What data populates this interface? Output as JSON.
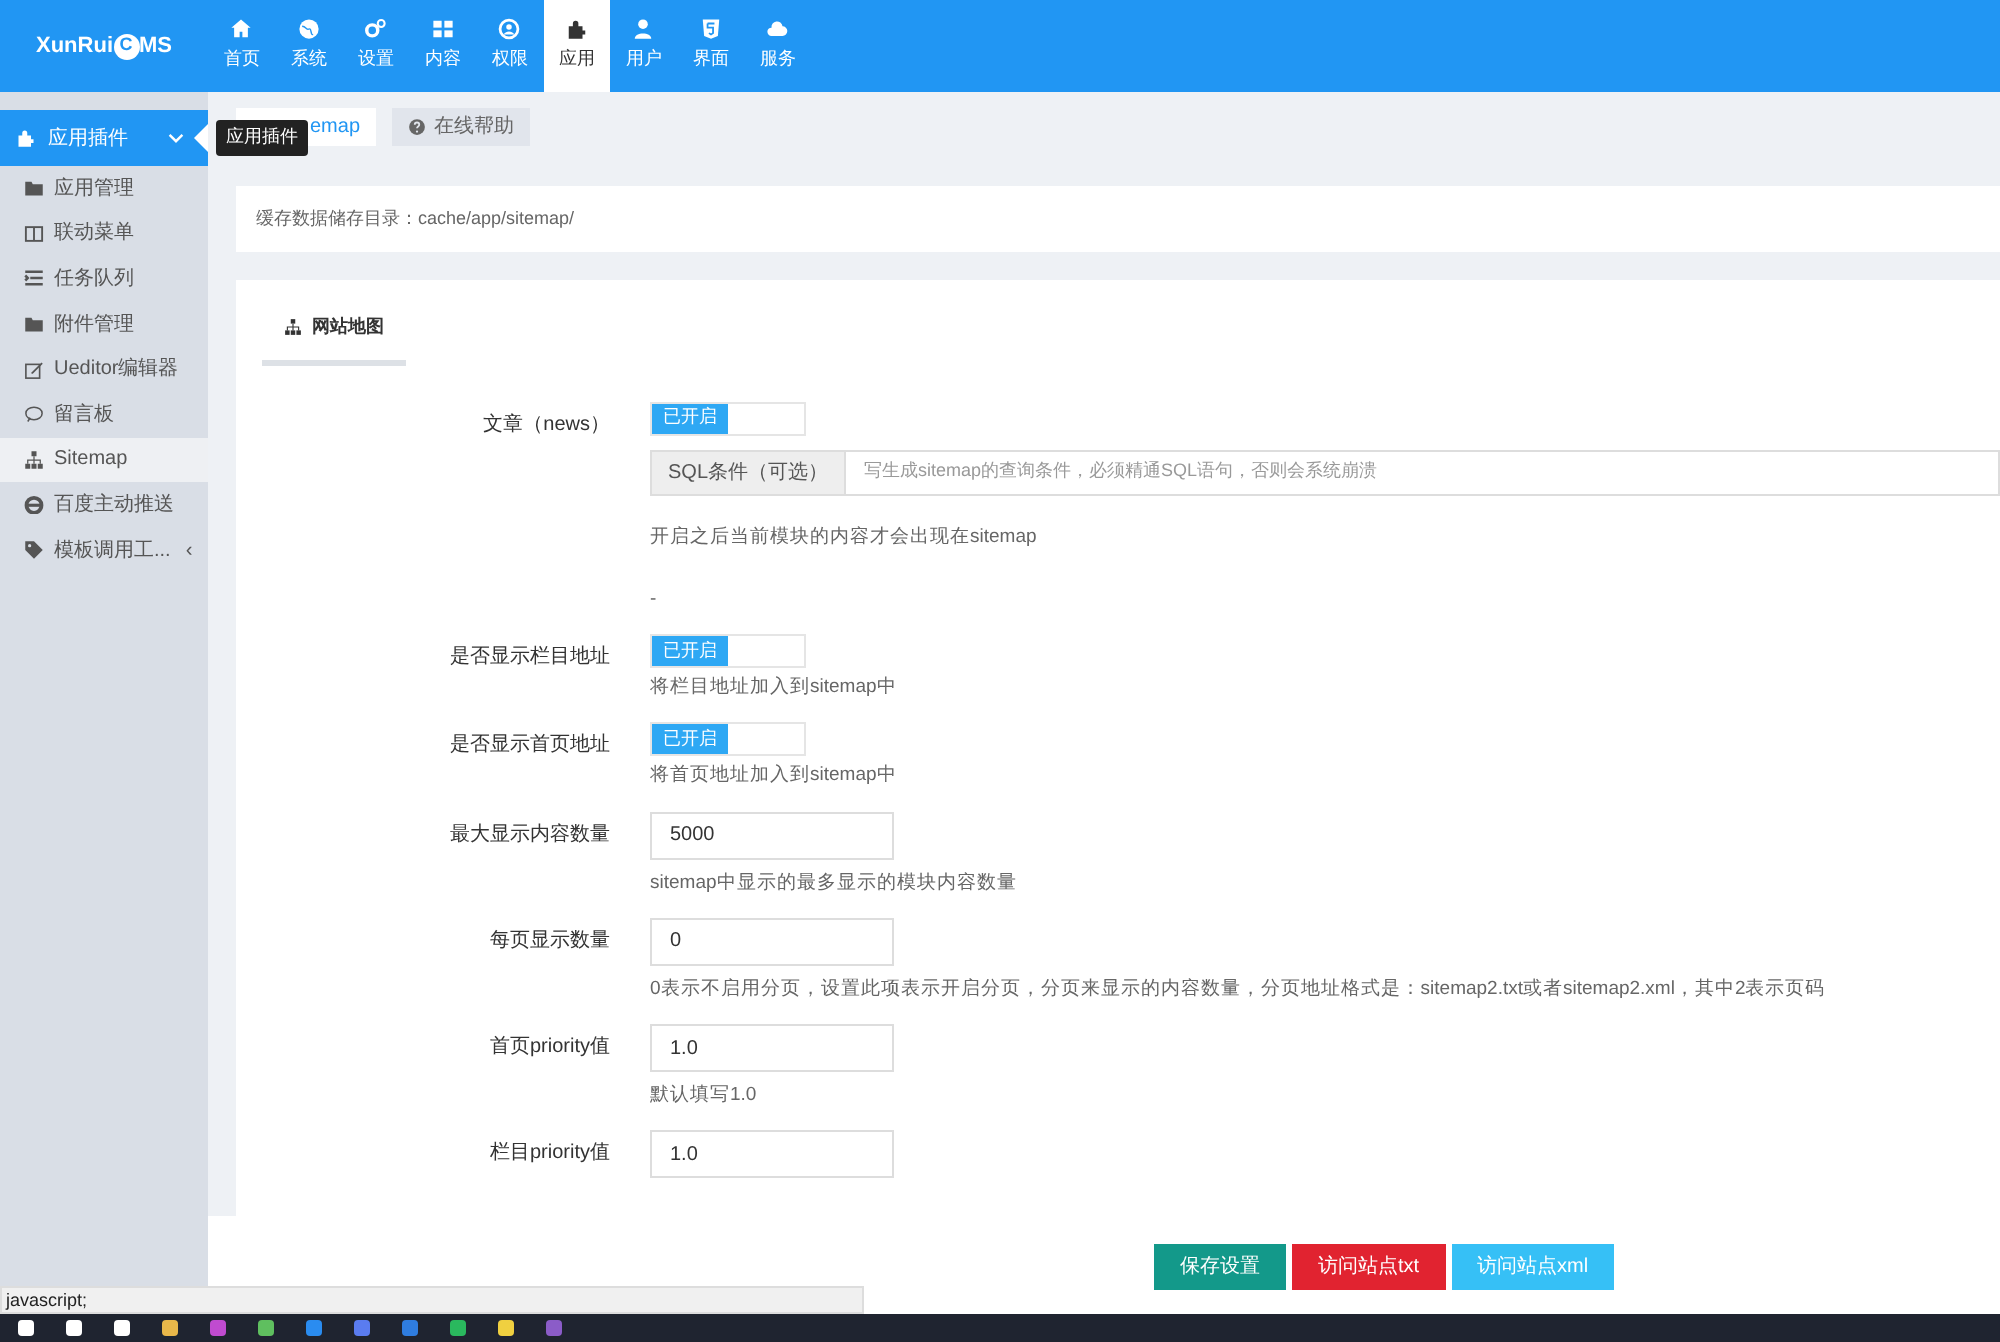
{
  "brand": {
    "prefix": "XunRui",
    "mark": "C",
    "suffix": "MS"
  },
  "nav": [
    {
      "label": "首页",
      "selected": false
    },
    {
      "label": "系统",
      "selected": false
    },
    {
      "label": "设置",
      "selected": false
    },
    {
      "label": "内容",
      "selected": false
    },
    {
      "label": "权限",
      "selected": false
    },
    {
      "label": "应用",
      "selected": true
    },
    {
      "label": "用户",
      "selected": false
    },
    {
      "label": "界面",
      "selected": false
    },
    {
      "label": "服务",
      "selected": false
    }
  ],
  "sidebar": {
    "header": {
      "label": "应用插件",
      "expanded": true
    },
    "tooltip": "应用插件",
    "items": [
      {
        "label": "应用管理",
        "selected": false
      },
      {
        "label": "联动菜单",
        "selected": false
      },
      {
        "label": "任务队列",
        "selected": false
      },
      {
        "label": "附件管理",
        "selected": false
      },
      {
        "label": "Ueditor编辑器",
        "selected": false
      },
      {
        "label": "留言板",
        "selected": false
      },
      {
        "label": "Sitemap",
        "selected": true
      },
      {
        "label": "百度主动推送",
        "selected": false
      },
      {
        "label": "模板调用工...",
        "selected": false,
        "caret": "‹"
      }
    ]
  },
  "tabs": [
    {
      "label": "emap",
      "selected": true
    },
    {
      "label": "在线帮助",
      "selected": false
    }
  ],
  "notice": "缓存数据储存目录：cache/app/sitemap/",
  "section_tab": "网站地图",
  "fields": [
    {
      "kind": "switch",
      "label": "文章（news）",
      "on": true,
      "switch_text": "已开启",
      "addon": "SQL条件（可选）",
      "placeholder": "写生成sitemap的查询条件，必须精通SQL语句，否则会系统崩溃",
      "help": "开启之后当前模块的内容才会出现在sitemap",
      "note": "-"
    },
    {
      "kind": "switch",
      "label": "是否显示栏目地址",
      "on": true,
      "switch_text": "已开启",
      "help": "将栏目地址加入到sitemap中"
    },
    {
      "kind": "switch",
      "label": "是否显示首页地址",
      "on": true,
      "switch_text": "已开启",
      "help": "将首页地址加入到sitemap中"
    },
    {
      "kind": "input",
      "label": "最大显示内容数量",
      "value": "5000",
      "help": "sitemap中显示的最多显示的模块内容数量"
    },
    {
      "kind": "input",
      "label": "每页显示数量",
      "value": "0",
      "help": "0表示不启用分页，设置此项表示开启分页，分页来显示的内容数量，分页地址格式是：sitemap2.txt或者sitemap2.xml，其中2表示页码"
    },
    {
      "kind": "input",
      "label": "首页priority值",
      "value": "1.0",
      "help": "默认填写1.0"
    },
    {
      "kind": "input",
      "label": "栏目priority值",
      "value": "1.0"
    }
  ],
  "buttons": [
    {
      "label": "保存设置"
    },
    {
      "label": "访问站点txt"
    },
    {
      "label": "访问站点xml"
    }
  ],
  "status_text": "javascript;"
}
